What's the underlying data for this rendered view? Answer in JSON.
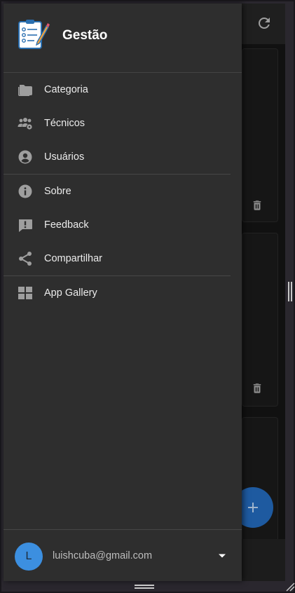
{
  "drawer": {
    "title": "Gestão",
    "menu_items": [
      {
        "label": "Categoria",
        "icon": "folder-icon"
      },
      {
        "label": "Técnicos",
        "icon": "users-cog-icon"
      },
      {
        "label": "Usuários",
        "icon": "user-circle-icon"
      },
      {
        "label": "Sobre",
        "icon": "info-icon"
      },
      {
        "label": "Feedback",
        "icon": "feedback-icon"
      },
      {
        "label": "Compartilhar",
        "icon": "share-icon"
      },
      {
        "label": "App Gallery",
        "icon": "grid-icon"
      }
    ],
    "account": {
      "avatar_letter": "L",
      "email": "luishcuba@gmail.com"
    }
  },
  "colors": {
    "drawer_bg": "#2e2e2e",
    "text": "#ececec",
    "icon": "#9e9e9e",
    "avatar_bg": "#3c8fe0",
    "fab": "#1e5aa0"
  }
}
